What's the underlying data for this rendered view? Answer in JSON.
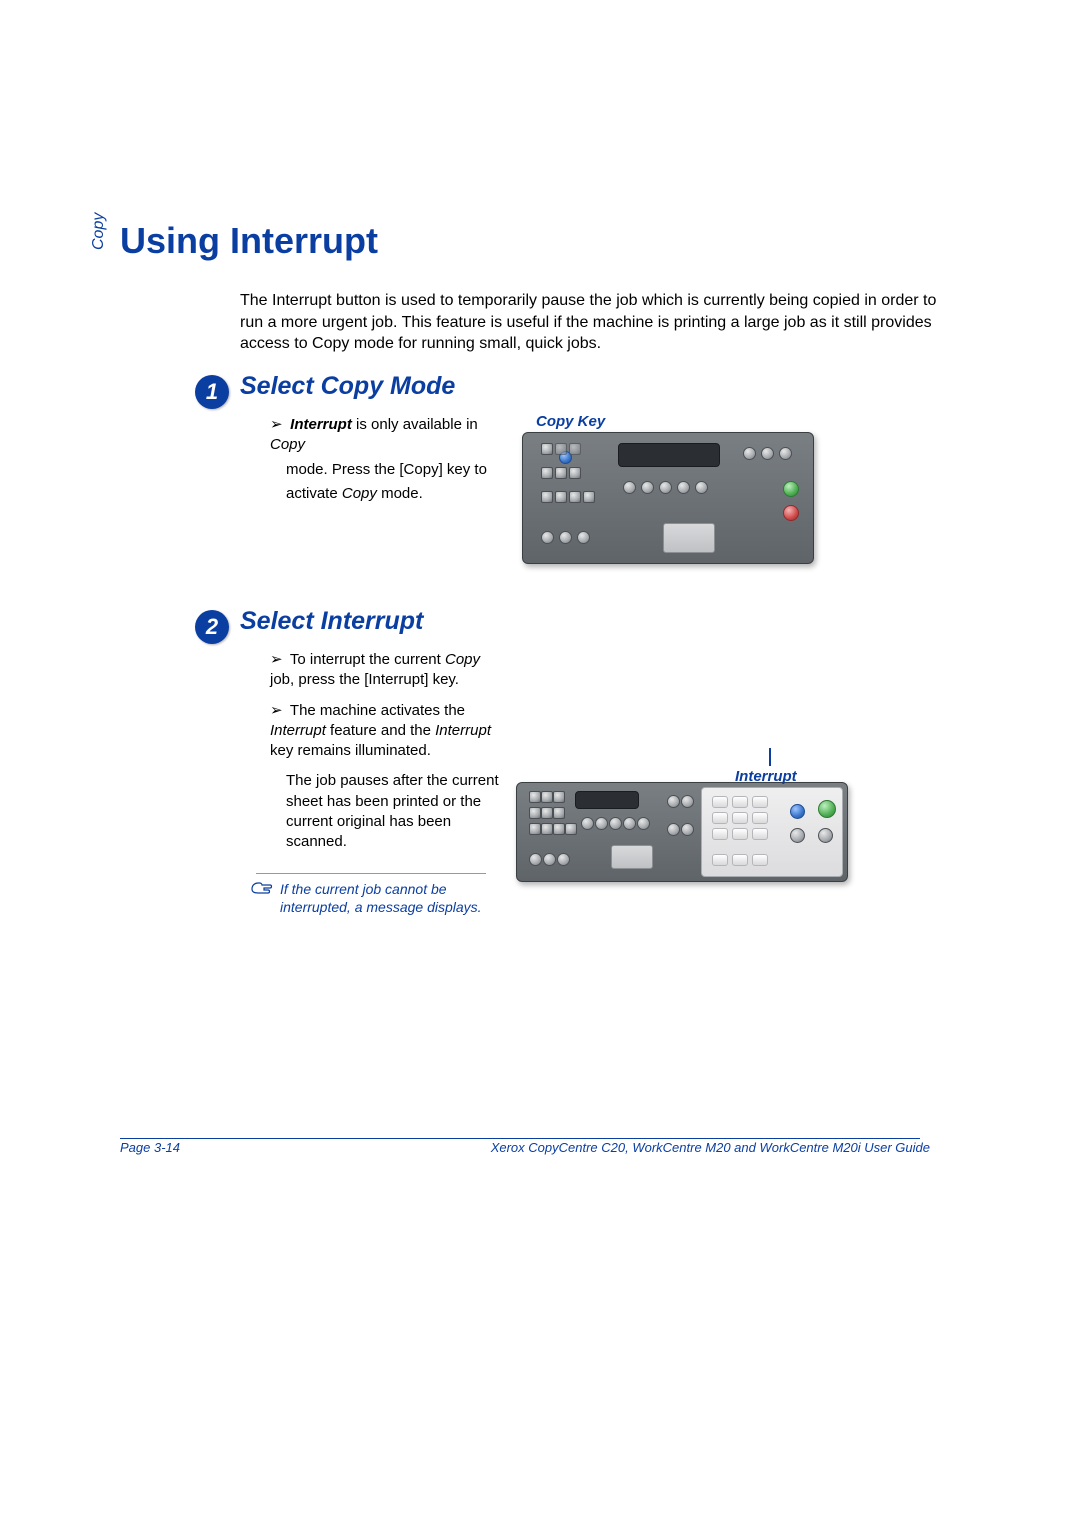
{
  "sideLabel": "Copy",
  "title": "Using Interrupt",
  "intro": "The Interrupt button is used to temporarily pause the job which is currently being copied in order to run a more urgent job. This feature is useful if the machine is printing a large job as it still provides access to Copy mode for running small, quick jobs.",
  "step1": {
    "num": "1",
    "title": "Select Copy Mode",
    "bullet_pre": "Interrupt",
    "bullet_mid": " is only available in ",
    "bullet_em": "Copy",
    "line2": "mode. Press the [Copy] key to",
    "line3_pre": "activate ",
    "line3_em": "Copy",
    "line3_post": " mode.",
    "figLabel": "Copy Key"
  },
  "step2": {
    "num": "2",
    "title": "Select Interrupt",
    "b1_pre": "To interrupt the current ",
    "b1_em": "Copy",
    "b1_post": " job, press the [Interrupt] key.",
    "b2_pre": "The machine activates the ",
    "b2_em1": "Interrupt",
    "b2_mid": " feature and the ",
    "b2_em2": "Interrupt",
    "b2_post": " key remains illuminated.",
    "b3": "The job pauses after the current sheet has been printed or the current original has been scanned.",
    "note": "If the current job cannot be interrupted, a message displays.",
    "figLabel": "Interrupt"
  },
  "footer": {
    "left": "Page 3-14",
    "right": "Xerox CopyCentre C20, WorkCentre M20 and WorkCentre M20i User Guide"
  },
  "glyphs": {
    "arrow": "➢"
  }
}
